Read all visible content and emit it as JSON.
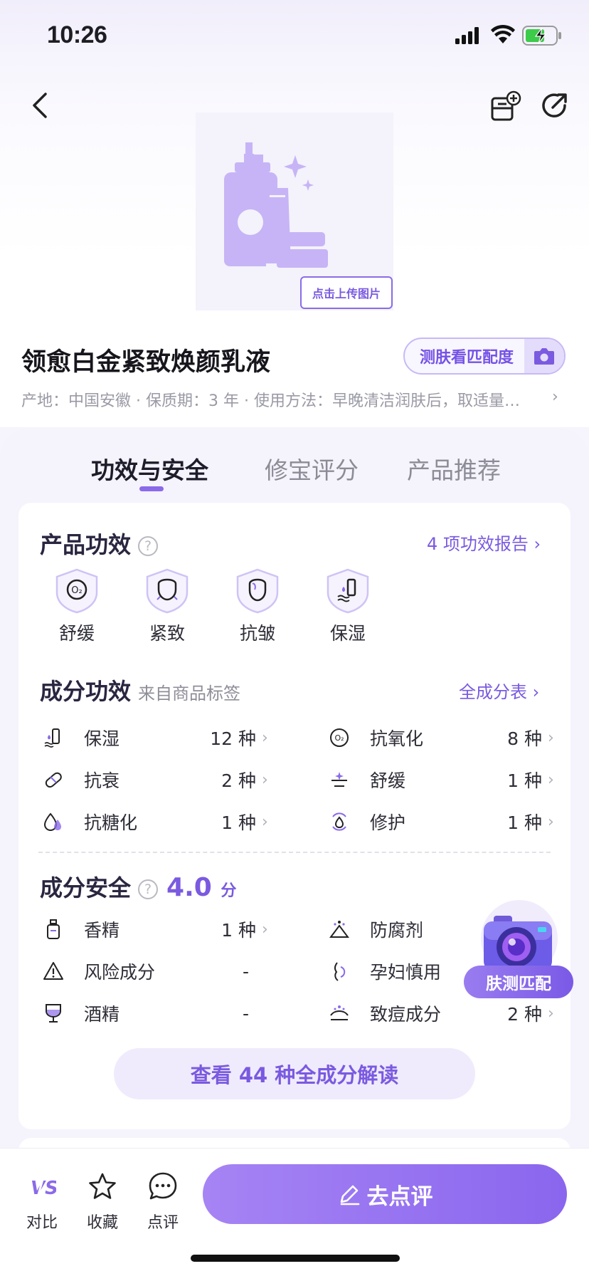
{
  "status": {
    "time": "10:26"
  },
  "hero": {
    "upload_label": "点击上传图片"
  },
  "product": {
    "title": "领愈白金紧致焕颜乳液",
    "skin_test_label": "测肤看匹配度",
    "meta": "产地：中国安徽 · 保质期：3 年 · 使用方法：早晚清洁润肤后，取适量…"
  },
  "tabs": [
    {
      "label": "功效与安全",
      "active": true
    },
    {
      "label": "修宝评分",
      "active": false
    },
    {
      "label": "产品推荐",
      "active": false
    }
  ],
  "efficacy": {
    "title": "产品功效",
    "report_link": "4 项功效报告",
    "items": [
      {
        "label": "舒缓",
        "icon": "o2-shield-icon"
      },
      {
        "label": "紧致",
        "icon": "face-lift-shield-icon"
      },
      {
        "label": "抗皱",
        "icon": "face-shield-icon"
      },
      {
        "label": "保湿",
        "icon": "moisture-shield-icon"
      }
    ]
  },
  "ingredient_effect": {
    "title": "成分功效",
    "subtitle": "来自商品标签",
    "link": "全成分表",
    "items": [
      {
        "label": "保湿",
        "value": "12 种",
        "icon": "moisture-bottle-icon"
      },
      {
        "label": "抗氧化",
        "value": "8 种",
        "icon": "o2-icon"
      },
      {
        "label": "抗衰",
        "value": "2 种",
        "icon": "capsule-icon"
      },
      {
        "label": "舒缓",
        "value": "1 种",
        "icon": "calm-icon"
      },
      {
        "label": "抗糖化",
        "value": "1 种",
        "icon": "drops-icon"
      },
      {
        "label": "修护",
        "value": "1 种",
        "icon": "repair-drop-icon"
      }
    ]
  },
  "safety": {
    "title": "成分安全",
    "score": "4.0",
    "score_unit": "分",
    "items": [
      {
        "label": "香精",
        "value": "1 种",
        "icon": "perfume-icon",
        "chevron": true
      },
      {
        "label": "防腐剂",
        "value": "",
        "icon": "preservative-icon",
        "chevron": false
      },
      {
        "label": "风险成分",
        "value": "-",
        "icon": "warning-icon",
        "chevron": false
      },
      {
        "label": "孕妇慎用",
        "value": "",
        "icon": "pregnant-icon",
        "chevron": false
      },
      {
        "label": "酒精",
        "value": "-",
        "icon": "wine-glass-icon",
        "chevron": false
      },
      {
        "label": "致痘成分",
        "value": "2 种",
        "icon": "acne-icon",
        "chevron": true
      }
    ],
    "all_button": "查看 44 种全成分解读"
  },
  "float_badge": {
    "label": "肤测匹配"
  },
  "bottom": {
    "compare": "对比",
    "favorite": "收藏",
    "comment": "点评",
    "review_button": "去点评"
  },
  "colors": {
    "accent": "#7a5ae0",
    "accent_light": "#efebfd"
  }
}
